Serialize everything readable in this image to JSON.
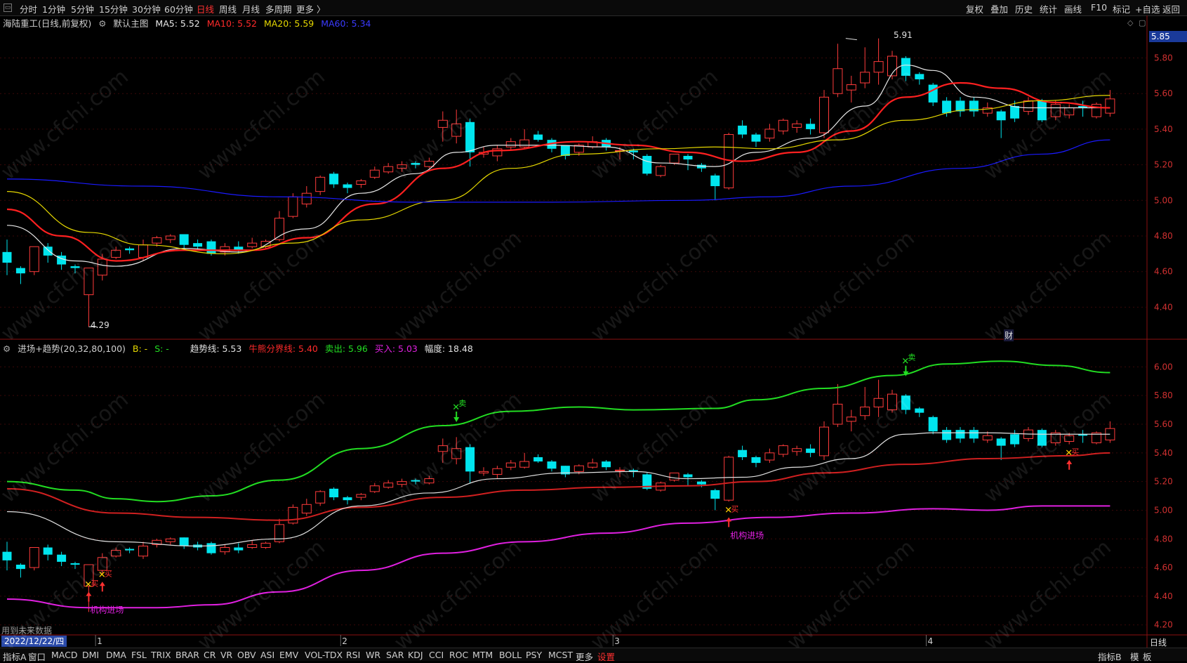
{
  "top_bar": {
    "periods": [
      "分时",
      "1分钟",
      "5分钟",
      "15分钟",
      "30分钟",
      "60分钟",
      "日线",
      "周线",
      "月线",
      "多周期",
      "更多 〉"
    ],
    "active_period": "日线",
    "tools": [
      "复权",
      "叠加",
      "历史",
      "统计",
      "画线",
      "F10",
      "标记",
      "+自选",
      "返回"
    ]
  },
  "main_panel": {
    "stock_title": "海陆重工(日线,前复权)",
    "indicator_name": "默认主图",
    "ma5": "MA5: 5.52",
    "ma10": "MA10: 5.52",
    "ma20": "MA20: 5.59",
    "ma60": "MA60: 5.34",
    "current_price_tag": "5.85",
    "high_label": "5.91",
    "low_label": "4.29",
    "finance_marker": "财",
    "y_ticks": [
      "5.80",
      "5.60",
      "5.40",
      "5.20",
      "5.00",
      "4.80",
      "4.60",
      "4.40"
    ]
  },
  "sub_panel": {
    "indicator_title": "进场+趋势(20,32,80,100)",
    "b_label": "B: -",
    "s_label": "S: -",
    "trend_line": "趋势线: 5.53",
    "bull_bear": "牛熊分界线: 5.40",
    "sell_line": "卖出: 5.96",
    "buy_line": "买入: 5.03",
    "amplitude": "幅度: 18.48",
    "y_ticks": [
      "6.00",
      "5.80",
      "5.60",
      "5.40",
      "5.20",
      "5.00",
      "4.80",
      "4.60",
      "4.40",
      "4.20"
    ],
    "buy_signal_text": "买",
    "sell_signal_text": "卖",
    "institution_text": "机构进场",
    "future_data_note": "用到未来数据"
  },
  "axis": {
    "month_labels": [
      "1",
      "2",
      "3",
      "4"
    ],
    "date_box": "2022/12/22/四",
    "period_box": "日线"
  },
  "bottom_bar": {
    "indicators": [
      "指标A",
      "窗口",
      "MACD",
      "DMI",
      "DMA",
      "FSL",
      "TRIX",
      "BRAR",
      "CR",
      "VR",
      "OBV",
      "ASI",
      "EMV",
      "VOL-TDX",
      "RSI",
      "WR",
      "SAR",
      "KDJ",
      "CCI",
      "ROC",
      "MTM",
      "BOLL",
      "PSY",
      "MCST",
      "更多",
      "设置"
    ],
    "right_items": [
      "指标B",
      "模",
      "板"
    ]
  },
  "watermark_text": "www.cfchi.com",
  "colors": {
    "up": "#ff3b3b",
    "down": "#00e5ee",
    "ma5": "#e8e8e8",
    "ma10": "#ff2020",
    "ma20": "#e6d800",
    "ma60": "#1a1aff",
    "sell_band": "#22dd22",
    "bull_bear": "#d02020",
    "buy_band": "#e020e0",
    "trend": "#e0e0e0"
  },
  "chart_data": {
    "type": "candlestick",
    "title": "海陆重工(日线,前复权)",
    "main_ylim": [
      4.22,
      5.96
    ],
    "sub_ylim": [
      4.13,
      6.09
    ],
    "month_boundaries_index": [
      7,
      25,
      45,
      68
    ],
    "candles": [
      {
        "o": 4.71,
        "c": 4.65,
        "h": 4.78,
        "l": 4.58
      },
      {
        "o": 4.62,
        "c": 4.59,
        "h": 4.63,
        "l": 4.53
      },
      {
        "o": 4.6,
        "c": 4.74,
        "h": 4.74,
        "l": 4.58
      },
      {
        "o": 4.74,
        "c": 4.69,
        "h": 4.76,
        "l": 4.65
      },
      {
        "o": 4.69,
        "c": 4.64,
        "h": 4.71,
        "l": 4.61
      },
      {
        "o": 4.63,
        "c": 4.62,
        "h": 4.64,
        "l": 4.59
      },
      {
        "o": 4.47,
        "c": 4.62,
        "h": 4.62,
        "l": 4.29
      },
      {
        "o": 4.58,
        "c": 4.67,
        "h": 4.7,
        "l": 4.55
      },
      {
        "o": 4.68,
        "c": 4.72,
        "h": 4.74,
        "l": 4.67
      },
      {
        "o": 4.73,
        "c": 4.72,
        "h": 4.74,
        "l": 4.7
      },
      {
        "o": 4.68,
        "c": 4.75,
        "h": 4.78,
        "l": 4.66
      },
      {
        "o": 4.76,
        "c": 4.79,
        "h": 4.8,
        "l": 4.74
      },
      {
        "o": 4.78,
        "c": 4.8,
        "h": 4.81,
        "l": 4.76
      },
      {
        "o": 4.81,
        "c": 4.75,
        "h": 4.81,
        "l": 4.73
      },
      {
        "o": 4.76,
        "c": 4.74,
        "h": 4.78,
        "l": 4.72
      },
      {
        "o": 4.77,
        "c": 4.7,
        "h": 4.78,
        "l": 4.69
      },
      {
        "o": 4.71,
        "c": 4.74,
        "h": 4.76,
        "l": 4.69
      },
      {
        "o": 4.74,
        "c": 4.72,
        "h": 4.77,
        "l": 4.7
      },
      {
        "o": 4.74,
        "c": 4.76,
        "h": 4.79,
        "l": 4.73
      },
      {
        "o": 4.74,
        "c": 4.77,
        "h": 4.78,
        "l": 4.73
      },
      {
        "o": 4.78,
        "c": 4.9,
        "h": 4.94,
        "l": 4.77
      },
      {
        "o": 4.91,
        "c": 5.02,
        "h": 5.04,
        "l": 4.9
      },
      {
        "o": 4.98,
        "c": 5.04,
        "h": 5.08,
        "l": 4.96
      },
      {
        "o": 5.05,
        "c": 5.13,
        "h": 5.14,
        "l": 5.03
      },
      {
        "o": 5.15,
        "c": 5.09,
        "h": 5.16,
        "l": 5.07
      },
      {
        "o": 5.09,
        "c": 5.07,
        "h": 5.1,
        "l": 5.04
      },
      {
        "o": 5.09,
        "c": 5.11,
        "h": 5.12,
        "l": 5.07
      },
      {
        "o": 5.13,
        "c": 5.17,
        "h": 5.19,
        "l": 5.12
      },
      {
        "o": 5.16,
        "c": 5.19,
        "h": 5.21,
        "l": 5.15
      },
      {
        "o": 5.18,
        "c": 5.2,
        "h": 5.22,
        "l": 5.16
      },
      {
        "o": 5.21,
        "c": 5.2,
        "h": 5.22,
        "l": 5.18
      },
      {
        "o": 5.19,
        "c": 5.22,
        "h": 5.24,
        "l": 5.18
      },
      {
        "o": 5.41,
        "c": 5.45,
        "h": 5.5,
        "l": 5.33
      },
      {
        "o": 5.36,
        "c": 5.43,
        "h": 5.51,
        "l": 5.32
      },
      {
        "o": 5.44,
        "c": 5.27,
        "h": 5.46,
        "l": 5.19
      },
      {
        "o": 5.26,
        "c": 5.27,
        "h": 5.3,
        "l": 5.24
      },
      {
        "o": 5.25,
        "c": 5.29,
        "h": 5.31,
        "l": 5.22
      },
      {
        "o": 5.3,
        "c": 5.33,
        "h": 5.35,
        "l": 5.28
      },
      {
        "o": 5.3,
        "c": 5.34,
        "h": 5.4,
        "l": 5.29
      },
      {
        "o": 5.37,
        "c": 5.34,
        "h": 5.39,
        "l": 5.33
      },
      {
        "o": 5.34,
        "c": 5.29,
        "h": 5.35,
        "l": 5.27
      },
      {
        "o": 5.31,
        "c": 5.25,
        "h": 5.31,
        "l": 5.23
      },
      {
        "o": 5.27,
        "c": 5.31,
        "h": 5.32,
        "l": 5.25
      },
      {
        "o": 5.3,
        "c": 5.33,
        "h": 5.36,
        "l": 5.29
      },
      {
        "o": 5.34,
        "c": 5.3,
        "h": 5.35,
        "l": 5.28
      },
      {
        "o": 5.28,
        "c": 5.28,
        "h": 5.3,
        "l": 5.23
      },
      {
        "o": 5.28,
        "c": 5.27,
        "h": 5.29,
        "l": 5.23
      },
      {
        "o": 5.25,
        "c": 5.15,
        "h": 5.26,
        "l": 5.14
      },
      {
        "o": 5.14,
        "c": 5.19,
        "h": 5.2,
        "l": 5.13
      },
      {
        "o": 5.21,
        "c": 5.26,
        "h": 5.26,
        "l": 5.2
      },
      {
        "o": 5.25,
        "c": 5.23,
        "h": 5.26,
        "l": 5.17
      },
      {
        "o": 5.2,
        "c": 5.18,
        "h": 5.21,
        "l": 5.16
      },
      {
        "o": 5.14,
        "c": 5.08,
        "h": 5.15,
        "l": 5.0
      },
      {
        "o": 5.07,
        "c": 5.37,
        "h": 5.38,
        "l": 5.06
      },
      {
        "o": 5.42,
        "c": 5.37,
        "h": 5.45,
        "l": 5.35
      },
      {
        "o": 5.37,
        "c": 5.33,
        "h": 5.38,
        "l": 5.3
      },
      {
        "o": 5.35,
        "c": 5.4,
        "h": 5.43,
        "l": 5.33
      },
      {
        "o": 5.39,
        "c": 5.45,
        "h": 5.46,
        "l": 5.37
      },
      {
        "o": 5.41,
        "c": 5.43,
        "h": 5.45,
        "l": 5.38
      },
      {
        "o": 5.43,
        "c": 5.4,
        "h": 5.46,
        "l": 5.37
      },
      {
        "o": 5.38,
        "c": 5.58,
        "h": 5.62,
        "l": 5.35
      },
      {
        "o": 5.6,
        "c": 5.74,
        "h": 5.88,
        "l": 5.58
      },
      {
        "o": 5.62,
        "c": 5.65,
        "h": 5.7,
        "l": 5.55
      },
      {
        "o": 5.66,
        "c": 5.72,
        "h": 5.86,
        "l": 5.63
      },
      {
        "o": 5.72,
        "c": 5.78,
        "h": 5.91,
        "l": 5.65
      },
      {
        "o": 5.7,
        "c": 5.81,
        "h": 5.84,
        "l": 5.68
      },
      {
        "o": 5.8,
        "c": 5.7,
        "h": 5.81,
        "l": 5.67
      },
      {
        "o": 5.71,
        "c": 5.68,
        "h": 5.72,
        "l": 5.65
      },
      {
        "o": 5.65,
        "c": 5.55,
        "h": 5.66,
        "l": 5.53
      },
      {
        "o": 5.56,
        "c": 5.49,
        "h": 5.58,
        "l": 5.47
      },
      {
        "o": 5.56,
        "c": 5.5,
        "h": 5.58,
        "l": 5.47
      },
      {
        "o": 5.56,
        "c": 5.5,
        "h": 5.58,
        "l": 5.47
      },
      {
        "o": 5.49,
        "c": 5.52,
        "h": 5.55,
        "l": 5.47
      },
      {
        "o": 5.5,
        "c": 5.45,
        "h": 5.51,
        "l": 5.35
      },
      {
        "o": 5.53,
        "c": 5.46,
        "h": 5.56,
        "l": 5.44
      },
      {
        "o": 5.5,
        "c": 5.56,
        "h": 5.58,
        "l": 5.48
      },
      {
        "o": 5.56,
        "c": 5.45,
        "h": 5.57,
        "l": 5.44
      },
      {
        "o": 5.47,
        "c": 5.54,
        "h": 5.56,
        "l": 5.45
      },
      {
        "o": 5.48,
        "c": 5.52,
        "h": 5.54,
        "l": 5.46
      },
      {
        "o": 5.53,
        "c": 5.52,
        "h": 5.56,
        "l": 5.47
      },
      {
        "o": 5.47,
        "c": 5.54,
        "h": 5.55,
        "l": 5.46
      },
      {
        "o": 5.49,
        "c": 5.57,
        "h": 5.62,
        "l": 5.47
      }
    ],
    "ma_series": [
      {
        "name": "MA5",
        "key": "ma5",
        "values": [
          [
            0,
            4.86
          ],
          [
            5,
            4.66
          ],
          [
            8,
            4.63
          ],
          [
            13,
            4.73
          ],
          [
            17,
            4.71
          ],
          [
            22,
            4.84
          ],
          [
            26,
            5.04
          ],
          [
            30,
            5.15
          ],
          [
            33,
            5.27
          ],
          [
            36,
            5.31
          ],
          [
            40,
            5.31
          ],
          [
            44,
            5.3
          ],
          [
            48,
            5.21
          ],
          [
            52,
            5.19
          ],
          [
            55,
            5.27
          ],
          [
            59,
            5.35
          ],
          [
            63,
            5.53
          ],
          [
            66,
            5.76
          ],
          [
            68,
            5.73
          ],
          [
            71,
            5.58
          ],
          [
            75,
            5.52
          ],
          [
            79,
            5.52
          ],
          [
            81,
            5.52
          ]
        ]
      },
      {
        "name": "MA10",
        "key": "ma10",
        "values": [
          [
            0,
            4.95
          ],
          [
            4,
            4.8
          ],
          [
            8,
            4.66
          ],
          [
            13,
            4.72
          ],
          [
            18,
            4.72
          ],
          [
            22,
            4.79
          ],
          [
            27,
            4.98
          ],
          [
            32,
            5.18
          ],
          [
            36,
            5.28
          ],
          [
            42,
            5.33
          ],
          [
            46,
            5.31
          ],
          [
            50,
            5.27
          ],
          [
            54,
            5.22
          ],
          [
            58,
            5.27
          ],
          [
            62,
            5.39
          ],
          [
            66,
            5.58
          ],
          [
            70,
            5.66
          ],
          [
            73,
            5.63
          ],
          [
            77,
            5.55
          ],
          [
            81,
            5.52
          ]
        ]
      },
      {
        "name": "MA20",
        "key": "ma20",
        "values": [
          [
            0,
            5.05
          ],
          [
            6,
            4.82
          ],
          [
            10,
            4.75
          ],
          [
            16,
            4.7
          ],
          [
            21,
            4.76
          ],
          [
            26,
            4.89
          ],
          [
            32,
            5.0
          ],
          [
            37,
            5.18
          ],
          [
            42,
            5.26
          ],
          [
            48,
            5.29
          ],
          [
            52,
            5.3
          ],
          [
            56,
            5.29
          ],
          [
            61,
            5.34
          ],
          [
            66,
            5.45
          ],
          [
            71,
            5.51
          ],
          [
            76,
            5.56
          ],
          [
            81,
            5.59
          ]
        ]
      },
      {
        "name": "MA60",
        "key": "ma60",
        "values": [
          [
            0,
            5.12
          ],
          [
            10,
            5.08
          ],
          [
            20,
            5.02
          ],
          [
            30,
            4.99
          ],
          [
            40,
            4.99
          ],
          [
            50,
            5.0
          ],
          [
            56,
            5.02
          ],
          [
            62,
            5.08
          ],
          [
            70,
            5.18
          ],
          [
            76,
            5.26
          ],
          [
            81,
            5.34
          ]
        ]
      }
    ],
    "sub_series": [
      {
        "name": "卖出",
        "key": "sell_band",
        "values": [
          [
            0,
            5.2
          ],
          [
            5,
            5.14
          ],
          [
            8,
            5.08
          ],
          [
            11,
            5.06
          ],
          [
            15,
            5.1
          ],
          [
            20,
            5.21
          ],
          [
            26,
            5.43
          ],
          [
            32,
            5.59
          ],
          [
            37,
            5.69
          ],
          [
            42,
            5.72
          ],
          [
            46,
            5.7
          ],
          [
            52,
            5.71
          ],
          [
            55,
            5.77
          ],
          [
            60,
            5.85
          ],
          [
            65,
            5.94
          ],
          [
            69,
            6.02
          ],
          [
            73,
            6.04
          ],
          [
            77,
            6.01
          ],
          [
            81,
            5.96
          ]
        ]
      },
      {
        "name": "牛熊分界线",
        "key": "bull_bear",
        "values": [
          [
            0,
            5.15
          ],
          [
            8,
            4.98
          ],
          [
            14,
            4.95
          ],
          [
            20,
            4.93
          ],
          [
            26,
            5.02
          ],
          [
            32,
            5.09
          ],
          [
            38,
            5.14
          ],
          [
            44,
            5.16
          ],
          [
            50,
            5.17
          ],
          [
            55,
            5.2
          ],
          [
            60,
            5.26
          ],
          [
            66,
            5.32
          ],
          [
            72,
            5.36
          ],
          [
            78,
            5.38
          ],
          [
            81,
            5.4
          ]
        ]
      },
      {
        "name": "买入",
        "key": "buy_band",
        "values": [
          [
            0,
            4.38
          ],
          [
            6,
            4.32
          ],
          [
            11,
            4.32
          ],
          [
            15,
            4.34
          ],
          [
            20,
            4.43
          ],
          [
            26,
            4.58
          ],
          [
            32,
            4.7
          ],
          [
            38,
            4.78
          ],
          [
            44,
            4.84
          ],
          [
            50,
            4.91
          ],
          [
            56,
            4.95
          ],
          [
            62,
            4.98
          ],
          [
            68,
            5.01
          ],
          [
            72,
            5.0
          ],
          [
            76,
            5.03
          ],
          [
            81,
            5.03
          ]
        ]
      },
      {
        "name": "趋势线",
        "key": "trend",
        "values": [
          [
            0,
            4.99
          ],
          [
            8,
            4.78
          ],
          [
            14,
            4.75
          ],
          [
            20,
            4.8
          ],
          [
            26,
            5.03
          ],
          [
            31,
            5.12
          ],
          [
            36,
            5.22
          ],
          [
            41,
            5.26
          ],
          [
            46,
            5.27
          ],
          [
            50,
            5.22
          ],
          [
            54,
            5.23
          ],
          [
            58,
            5.3
          ],
          [
            62,
            5.36
          ],
          [
            66,
            5.53
          ],
          [
            68,
            5.54
          ],
          [
            72,
            5.54
          ],
          [
            76,
            5.53
          ],
          [
            81,
            5.53
          ]
        ]
      }
    ],
    "sub_signals": [
      {
        "index": 6,
        "type": "buy",
        "price": 4.48,
        "institution": true
      },
      {
        "index": 7,
        "type": "buy",
        "price": 4.55
      },
      {
        "index": 33,
        "type": "sell",
        "price": 5.6
      },
      {
        "index": 53,
        "type": "buy",
        "price": 5.0,
        "institution": true
      },
      {
        "index": 66,
        "type": "sell",
        "price": 5.92
      },
      {
        "index": 78,
        "type": "buy",
        "price": 5.4
      }
    ]
  }
}
